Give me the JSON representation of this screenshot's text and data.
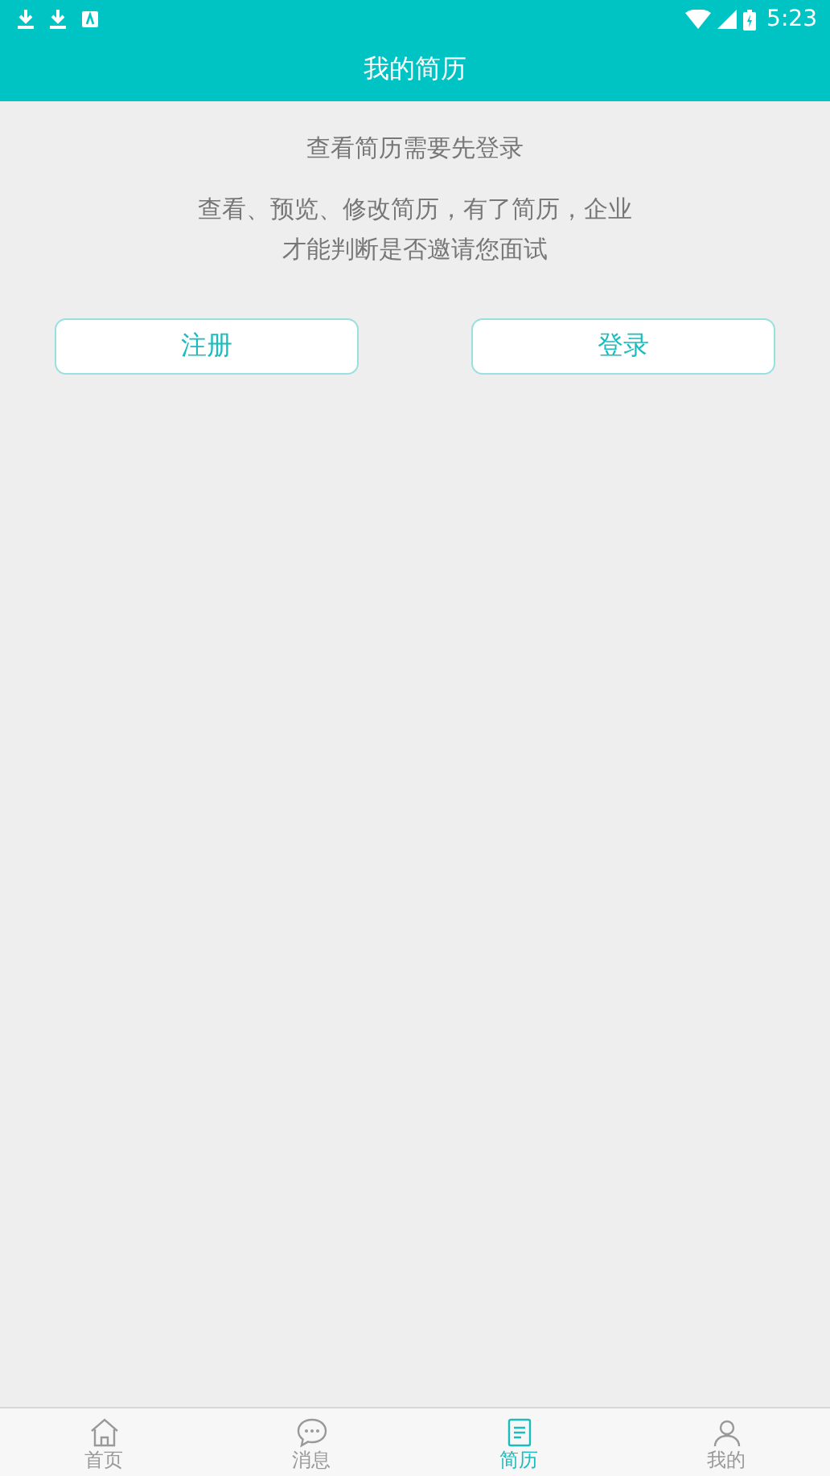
{
  "status_bar": {
    "time": "5:23"
  },
  "header": {
    "title": "我的简历"
  },
  "notice": {
    "title": "查看简历需要先登录",
    "message": "查看、预览、修改简历，有了简历，企业才能判断是否邀请您面试"
  },
  "buttons": [
    {
      "label": "注册"
    },
    {
      "label": "登录"
    }
  ],
  "tabs": [
    {
      "label": "首页",
      "kind": "home",
      "selected": false
    },
    {
      "label": "消息",
      "kind": "chat",
      "selected": false
    },
    {
      "label": "简历",
      "kind": "resume",
      "selected": true
    },
    {
      "label": "我的",
      "kind": "person",
      "selected": false
    }
  ]
}
